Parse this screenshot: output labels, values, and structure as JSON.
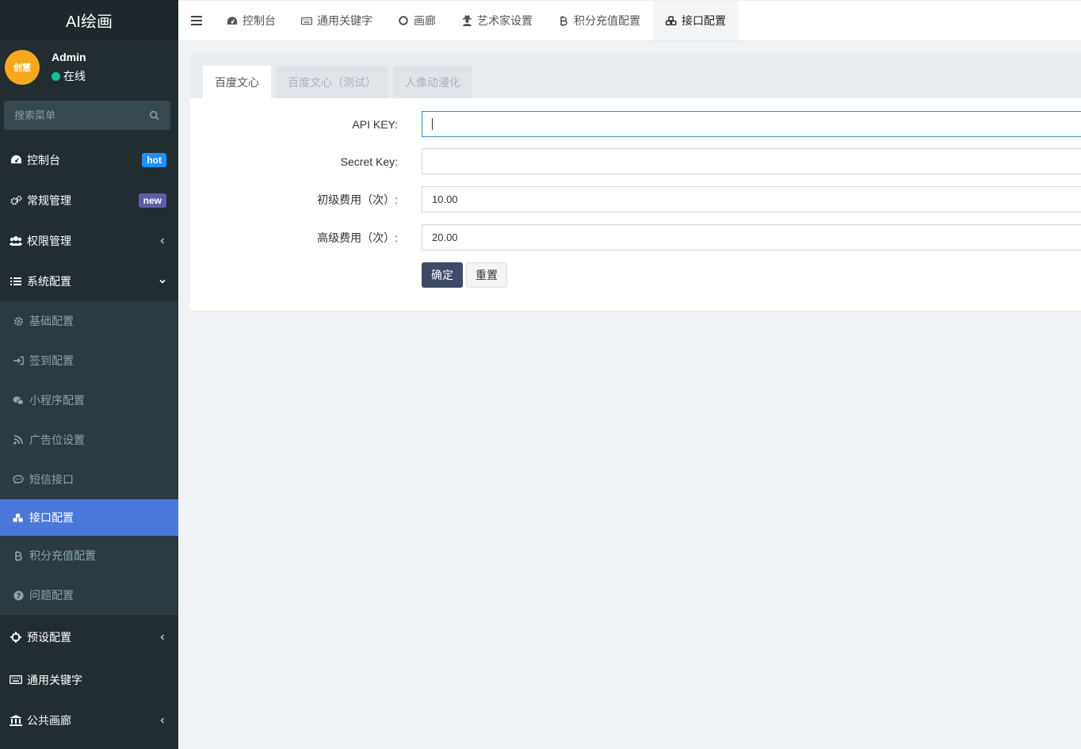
{
  "app": {
    "title": "AI绘画"
  },
  "user": {
    "avatar_text": "创慧",
    "name": "Admin",
    "status": "在线"
  },
  "search": {
    "placeholder": "搜索菜单"
  },
  "sidebar": {
    "items": [
      {
        "label": "控制台",
        "icon": "dashboard-icon",
        "badge": "hot"
      },
      {
        "label": "常规管理",
        "icon": "cogs-icon",
        "badge": "new"
      },
      {
        "label": "权限管理",
        "icon": "users-icon"
      },
      {
        "label": "系统配置",
        "icon": "list-icon"
      },
      {
        "label": "预设配置",
        "icon": "crosshairs-icon"
      },
      {
        "label": "通用关键字",
        "icon": "keyboard-icon"
      },
      {
        "label": "公共画廊",
        "icon": "bank-icon"
      }
    ],
    "sub_items": [
      {
        "label": "基础配置",
        "icon": "gear-icon"
      },
      {
        "label": "签到配置",
        "icon": "sign-in-icon"
      },
      {
        "label": "小程序配置",
        "icon": "wechat-icon"
      },
      {
        "label": "广告位设置",
        "icon": "rss-icon"
      },
      {
        "label": "短信接口",
        "icon": "comment-icon"
      },
      {
        "label": "接口配置",
        "icon": "cubes-icon",
        "active": true
      },
      {
        "label": "积分充值配置",
        "icon": "bitcoin-icon"
      },
      {
        "label": "问题配置",
        "icon": "question-icon"
      }
    ]
  },
  "topbar": {
    "tabs": [
      {
        "label": "控制台",
        "icon": "dashboard-icon"
      },
      {
        "label": "通用关键字",
        "icon": "keyboard-icon"
      },
      {
        "label": "画廊",
        "icon": "circle-icon"
      },
      {
        "label": "艺术家设置",
        "icon": "user-secret-icon"
      },
      {
        "label": "积分充值配置",
        "icon": "bitcoin-icon"
      },
      {
        "label": "接口配置",
        "icon": "cubes-icon",
        "active": true
      }
    ]
  },
  "panel": {
    "tabs": [
      {
        "label": "百度文心",
        "active": true
      },
      {
        "label": "百度文心（测试）"
      },
      {
        "label": "人像动漫化"
      }
    ],
    "form": {
      "api_key": {
        "label": "API KEY:",
        "value": ""
      },
      "secret_key": {
        "label": "Secret Key:",
        "value": ""
      },
      "basic_fee": {
        "label": "初级费用（次）:",
        "value": "10.00"
      },
      "advanced_fee": {
        "label": "高级费用（次）:",
        "value": "20.00"
      }
    },
    "submit_label": "确定",
    "reset_label": "重置"
  },
  "colors": {
    "sidebar_bg": "#222d32",
    "active_item": "#4a78d8",
    "primary_button": "#3f4a68"
  }
}
